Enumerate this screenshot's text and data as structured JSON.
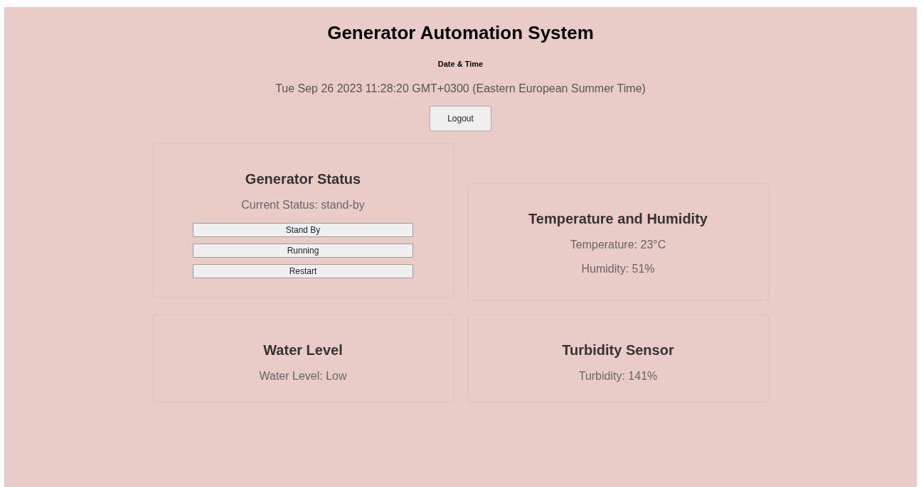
{
  "page": {
    "title": "Generator Automation System",
    "datetime_label": "Date & Time",
    "datetime": "Tue Sep 26 2023 11:28:20 GMT+0300 (Eastern European Summer Time)",
    "logout_button": "Logout"
  },
  "cards": [
    {
      "kind": "control",
      "title": "Generator Status",
      "status": "Current Status: stand-by",
      "buttons": [
        "Stand By",
        "Running",
        "Restart"
      ]
    },
    {
      "kind": "readings",
      "title": "Temperature and Humidity",
      "readings": [
        "Temperature: 23°C",
        "Humidity: 51%"
      ]
    },
    {
      "kind": "readings",
      "title": "Water Level",
      "readings": [
        "Water Level: Low"
      ]
    },
    {
      "kind": "readings",
      "title": "Turbidity Sensor",
      "readings": [
        "Turbidity: 141%"
      ]
    }
  ]
}
